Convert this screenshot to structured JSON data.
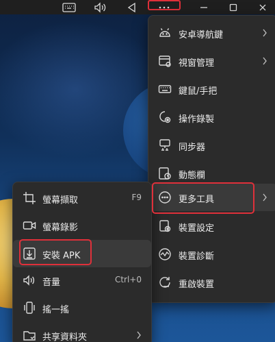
{
  "toolbar": {
    "icons": [
      "keyboard-icon",
      "volume-icon",
      "back-icon",
      "more-icon",
      "minimize-icon",
      "maximize-icon",
      "close-icon"
    ]
  },
  "more_menu": {
    "items": [
      {
        "label": "安卓導航鍵",
        "icon": "android-icon",
        "submenu": true
      },
      {
        "label": "視窗管理",
        "icon": "window-icon",
        "submenu": true
      },
      {
        "label": "鍵鼠/手把",
        "icon": "keyboard-icon",
        "submenu": false
      },
      {
        "label": "操作錄製",
        "icon": "record-icon",
        "submenu": false
      },
      {
        "label": "同步器",
        "icon": "sync-icon",
        "submenu": false
      },
      {
        "label": "動態欄",
        "icon": "dynamic-bar-icon",
        "submenu": false
      },
      {
        "label": "更多工具",
        "icon": "more-circle-icon",
        "submenu": true
      },
      {
        "label": "裝置設定",
        "icon": "settings-icon",
        "submenu": false
      },
      {
        "label": "裝置診斷",
        "icon": "diagnostics-icon",
        "submenu": false
      },
      {
        "label": "重啟裝置",
        "icon": "restart-icon",
        "submenu": false
      }
    ]
  },
  "tools_menu": {
    "items": [
      {
        "label": "螢幕擷取",
        "icon": "crop-icon",
        "shortcut": "F9"
      },
      {
        "label": "螢幕錄影",
        "icon": "video-icon",
        "shortcut": ""
      },
      {
        "label": "安裝 APK",
        "icon": "install-icon",
        "shortcut": ""
      },
      {
        "label": "音量",
        "icon": "volume-icon",
        "shortcut": "Ctrl+0"
      },
      {
        "label": "搖一搖",
        "icon": "shake-icon",
        "shortcut": ""
      },
      {
        "label": "共享資料夾",
        "icon": "folder-icon",
        "shortcut": ""
      }
    ]
  },
  "highlight_color": "#e0303a"
}
